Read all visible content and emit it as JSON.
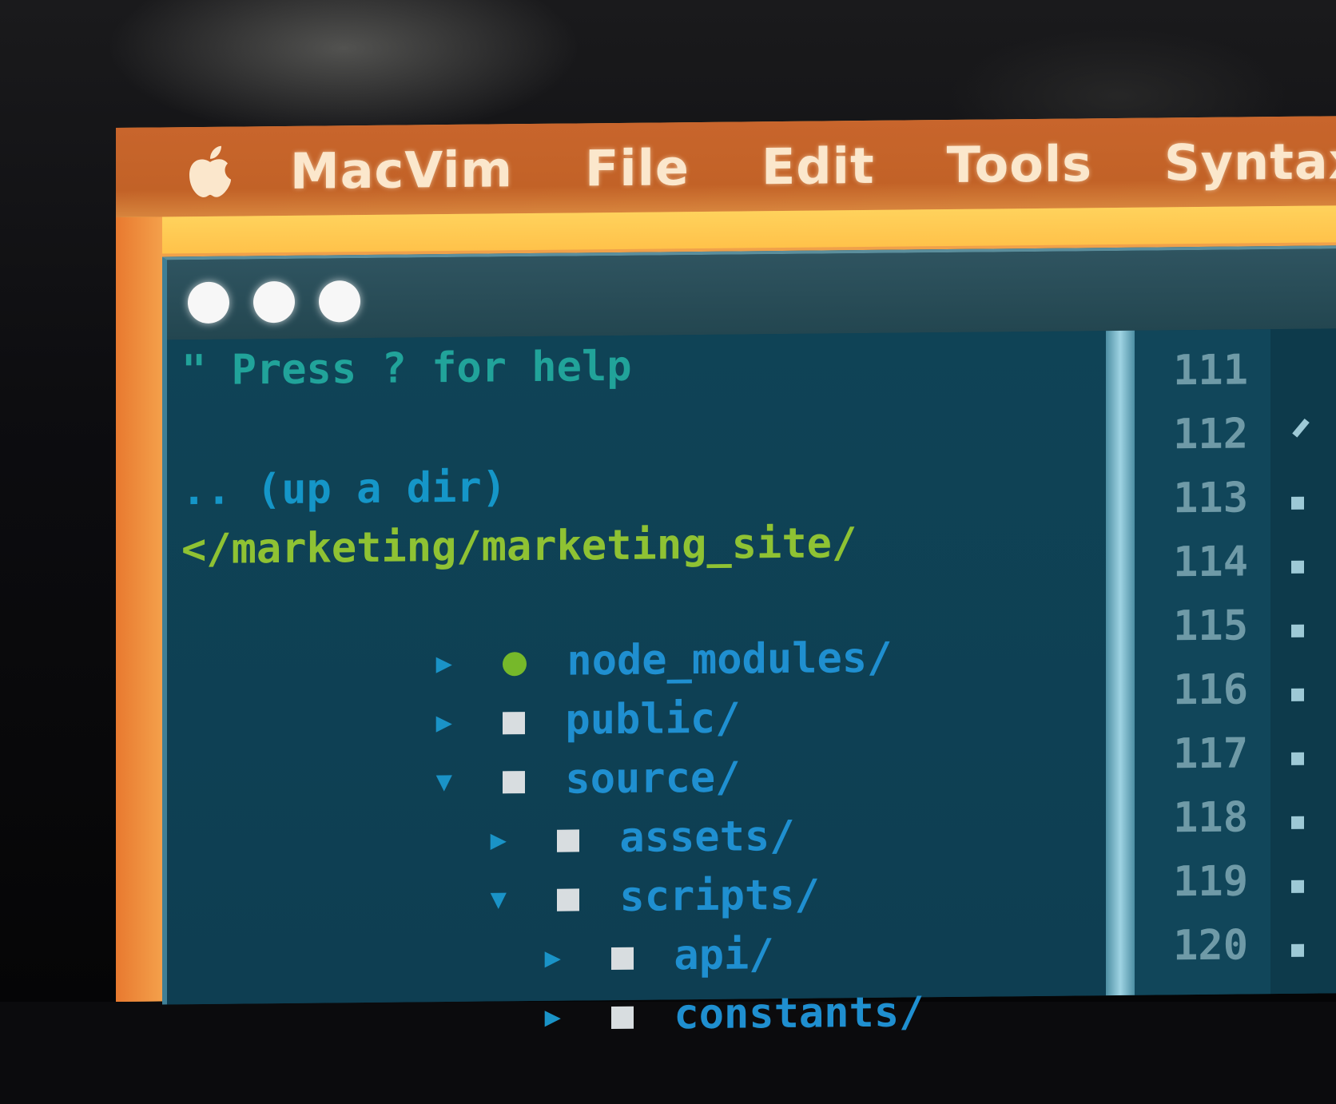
{
  "menubar": {
    "apple_icon": "apple-logo-icon",
    "items": [
      "MacVim",
      "File",
      "Edit",
      "Tools",
      "Syntax"
    ]
  },
  "window": {
    "traffic_lights": [
      "close-button",
      "minimize-button",
      "zoom-button"
    ]
  },
  "nerdtree": {
    "help": "\" Press ? for help",
    "up_dir": ".. (up a dir)",
    "root": "</marketing/marketing_site/",
    "entries": [
      {
        "marker": "▸",
        "name": "node_modules/",
        "icon": "green-dot"
      },
      {
        "marker": "▸",
        "name": "public/",
        "icon": "folder-square"
      },
      {
        "marker": "▾",
        "name": "source/",
        "icon": "folder-square"
      },
      {
        "marker": "▸",
        "name": "assets/",
        "icon": "folder-square"
      },
      {
        "marker": "▾",
        "name": "scripts/",
        "icon": "folder-square"
      },
      {
        "marker": "▸",
        "name": "api/",
        "icon": "folder-square"
      },
      {
        "marker": "▸",
        "name": "constants/",
        "icon": "folder-square"
      }
    ]
  },
  "gutter": {
    "line_numbers": [
      "111",
      "112",
      "113",
      "114",
      "115",
      "116",
      "117",
      "118",
      "119",
      "120"
    ]
  },
  "colors": {
    "menubar": "#c8652c",
    "highlight_strip": "#ffc24a",
    "editor_bg": "#103a4d",
    "root_path": "#8fc233",
    "directory": "#1f8fd0",
    "help_text": "#21a39a"
  }
}
